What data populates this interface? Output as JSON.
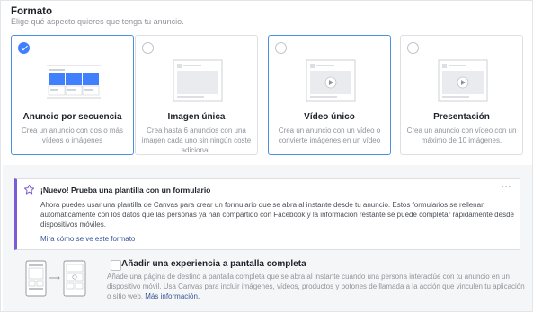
{
  "section": {
    "title": "Formato",
    "subtitle": "Elige qué aspecto quieres que tenga tu anuncio."
  },
  "formats": [
    {
      "title": "Anuncio por secuencia",
      "description": "Crea un anuncio con dos o más vídeos o imágenes",
      "selected": true,
      "icon": "carousel-preview-icon"
    },
    {
      "title": "Imagen única",
      "description": "Crea hasta 6 anuncios con una imagen cada uno sin ningún coste adicional.",
      "selected": false,
      "icon": "single-image-preview-icon"
    },
    {
      "title": "Vídeo único",
      "description": "Crea un anuncio con un vídeo o convierte imágenes en un vídeo",
      "selected": false,
      "icon": "single-video-preview-icon"
    },
    {
      "title": "Presentación",
      "description": "Crea un anuncio con vídeo con un máximo de 10 imágenes.",
      "selected": false,
      "icon": "slideshow-preview-icon"
    }
  ],
  "tip": {
    "title": "¡Nuevo! Prueba una plantilla con un formulario",
    "body": "Ahora puedes usar una plantilla de Canvas para crear un formulario que se abra al instante desde tu anuncio. Estos formularios se rellenan automáticamente con los datos que las personas ya han compartido con Facebook y la información restante se puede completar rápidamente desde dispositivos móviles.",
    "link": "Mira cómo se ve este formato",
    "more": "···",
    "accent": "#7b5cd6"
  },
  "fullscreen": {
    "title": "Añadir una experiencia a pantalla completa",
    "description": "Añade una página de destino a pantalla completa que se abra al instante cuando una persona interactúe con tu anuncio en un dispositivo móvil. Usa Canvas para incluir imágenes, vídeos, productos y botones de llamada a la acción que vinculen tu aplicación o sitio web.",
    "link": "Más información.",
    "checked": false
  },
  "colors": {
    "accent_blue": "#4080ff",
    "link": "#365899",
    "selected_border": "#4a90e2"
  }
}
